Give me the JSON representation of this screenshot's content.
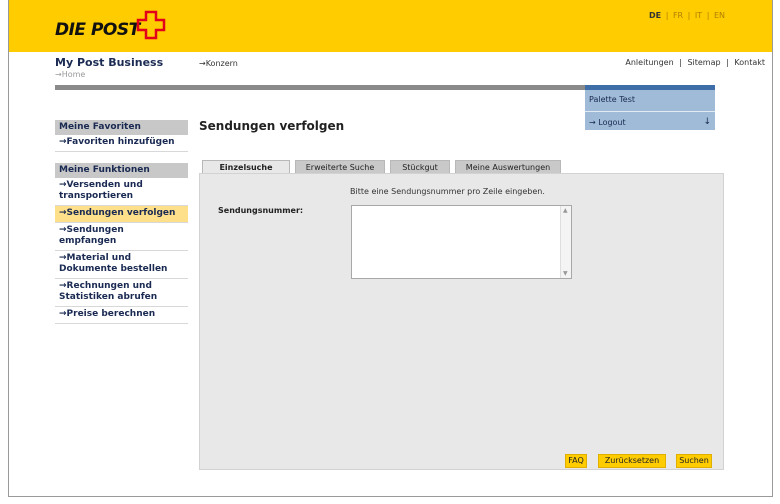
{
  "header": {
    "logo_text": "DIE POST",
    "languages": [
      {
        "label": "DE",
        "active": true
      },
      {
        "label": "FR",
        "active": false
      },
      {
        "label": "IT",
        "active": false
      },
      {
        "label": "EN",
        "active": false
      }
    ],
    "brand_color": "#ffcc00"
  },
  "subheader": {
    "title": "My Post Business",
    "breadcrumb": "→Home",
    "konzern_link": "→Konzern",
    "links": [
      "Anleitungen",
      "Sitemap",
      "Kontakt"
    ]
  },
  "user": {
    "name": "Palette Test",
    "logout_label": "→ Logout",
    "arrow": "↓"
  },
  "sidebar": {
    "favorites_heading": "Meine Favoriten",
    "favorites_items": [
      "→Favoriten hinzufügen"
    ],
    "functions_heading": "Meine Funktionen",
    "functions_items": [
      {
        "label": "→Versenden und transportieren",
        "active": false
      },
      {
        "label": "→Sendungen verfolgen",
        "active": true
      },
      {
        "label": "→Sendungen empfangen",
        "active": false
      },
      {
        "label": "→Material und Dokumente bestellen",
        "active": false
      },
      {
        "label": "→Rechnungen und Statistiken abrufen",
        "active": false
      },
      {
        "label": "→Preise berechnen",
        "active": false
      }
    ]
  },
  "main": {
    "title": "Sendungen verfolgen",
    "tabs": [
      {
        "label": "Einzelsuche",
        "active": true
      },
      {
        "label": "Erweiterte Suche",
        "active": false
      },
      {
        "label": "Stückgut",
        "active": false
      },
      {
        "label": "Meine Auswertungen",
        "active": false
      }
    ],
    "hint": "Bitte eine Sendungsnummer pro Zeile eingeben.",
    "field_label": "Sendungsnummer:",
    "field_value": "",
    "buttons": {
      "faq": "FAQ",
      "reset": "Zurücksetzen",
      "search": "Suchen"
    }
  }
}
